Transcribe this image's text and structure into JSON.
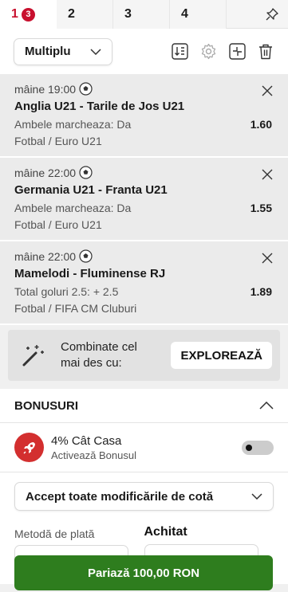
{
  "tabs": [
    {
      "label": "1",
      "badge": "3",
      "active": true
    },
    {
      "label": "2"
    },
    {
      "label": "3"
    },
    {
      "label": "4"
    }
  ],
  "toolbar": {
    "bet_type": "Multiplu",
    "icons": [
      "sort-icon",
      "settings-icon",
      "collapse-icon",
      "trash-icon"
    ]
  },
  "bets": [
    {
      "time": "mâine 19:00",
      "match": "Anglia U21 - Tarile de Jos U21",
      "market": "Ambele marcheaza: Da",
      "odd": "1.60",
      "league": "Fotbal / Euro U21"
    },
    {
      "time": "mâine 22:00",
      "match": "Germania U21 - Franta U21",
      "market": "Ambele marcheaza: Da",
      "odd": "1.55",
      "league": "Fotbal / Euro U21"
    },
    {
      "time": "mâine 22:00",
      "match": "Mamelodi - Fluminense RJ",
      "market": "Total goluri 2.5: + 2.5",
      "odd": "1.89",
      "league": "Fotbal / FIFA CM Cluburi"
    }
  ],
  "combo": {
    "text": "Combinate cel mai des cu:",
    "button": "EXPLOREAZĂ"
  },
  "bonus": {
    "header": "BONUSURI",
    "title": "4% Cât Casa",
    "subtitle": "Activează Bonusul"
  },
  "accept": {
    "label": "Accept toate modificările de cotă"
  },
  "payment": {
    "method_label": "Metodă de plată",
    "paid_label": "Achitat"
  },
  "cta": {
    "label": "Pariază 100,00 RON"
  },
  "colors": {
    "accent": "#c8102e",
    "cta": "#2e7d1e",
    "bet_bg": "#ebebeb"
  }
}
